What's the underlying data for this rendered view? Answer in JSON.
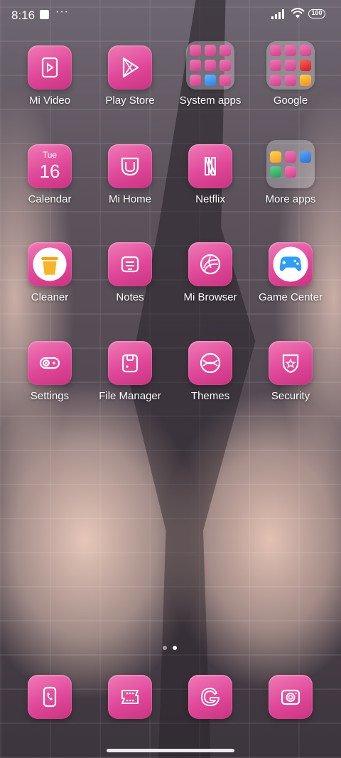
{
  "status_bar": {
    "time": "8:16",
    "dots": "···",
    "battery": "100"
  },
  "rows": [
    [
      {
        "name": "mi-video",
        "label": "Mi Video",
        "icon": "video-icon"
      },
      {
        "name": "play-store",
        "label": "Play Store",
        "icon": "play-icon"
      },
      {
        "name": "system-apps",
        "label": "System apps",
        "icon": "folder-icon"
      },
      {
        "name": "google",
        "label": "Google",
        "icon": "folder-icon"
      }
    ],
    [
      {
        "name": "calendar",
        "label": "Calendar",
        "icon": "calendar-icon",
        "day": "Tue",
        "date": "16"
      },
      {
        "name": "mi-home",
        "label": "Mi Home",
        "icon": "mi-home-icon"
      },
      {
        "name": "netflix",
        "label": "Netflix",
        "icon": "netflix-icon"
      },
      {
        "name": "more-apps",
        "label": "More apps",
        "icon": "folder-icon"
      }
    ],
    [
      {
        "name": "cleaner",
        "label": "Cleaner",
        "icon": "trash-icon"
      },
      {
        "name": "notes",
        "label": "Notes",
        "icon": "notes-icon"
      },
      {
        "name": "mi-browser",
        "label": "Mi Browser",
        "icon": "browser-icon"
      },
      {
        "name": "game-center",
        "label": "Game Center",
        "icon": "gamepad-icon"
      }
    ],
    [
      {
        "name": "settings",
        "label": "Settings",
        "icon": "toggle-icon"
      },
      {
        "name": "file-manager",
        "label": "File Manager",
        "icon": "folder-file-icon"
      },
      {
        "name": "themes",
        "label": "Themes",
        "icon": "themes-icon"
      },
      {
        "name": "security",
        "label": "Security",
        "icon": "shield-icon"
      }
    ]
  ],
  "dock": [
    {
      "name": "phone",
      "icon": "phone-icon"
    },
    {
      "name": "messages",
      "icon": "message-icon"
    },
    {
      "name": "google-search",
      "icon": "google-g-icon"
    },
    {
      "name": "camera",
      "icon": "camera-icon"
    }
  ],
  "colors": {
    "icon_pink": "#e0489a",
    "icon_pink_light": "#f07ab6"
  }
}
